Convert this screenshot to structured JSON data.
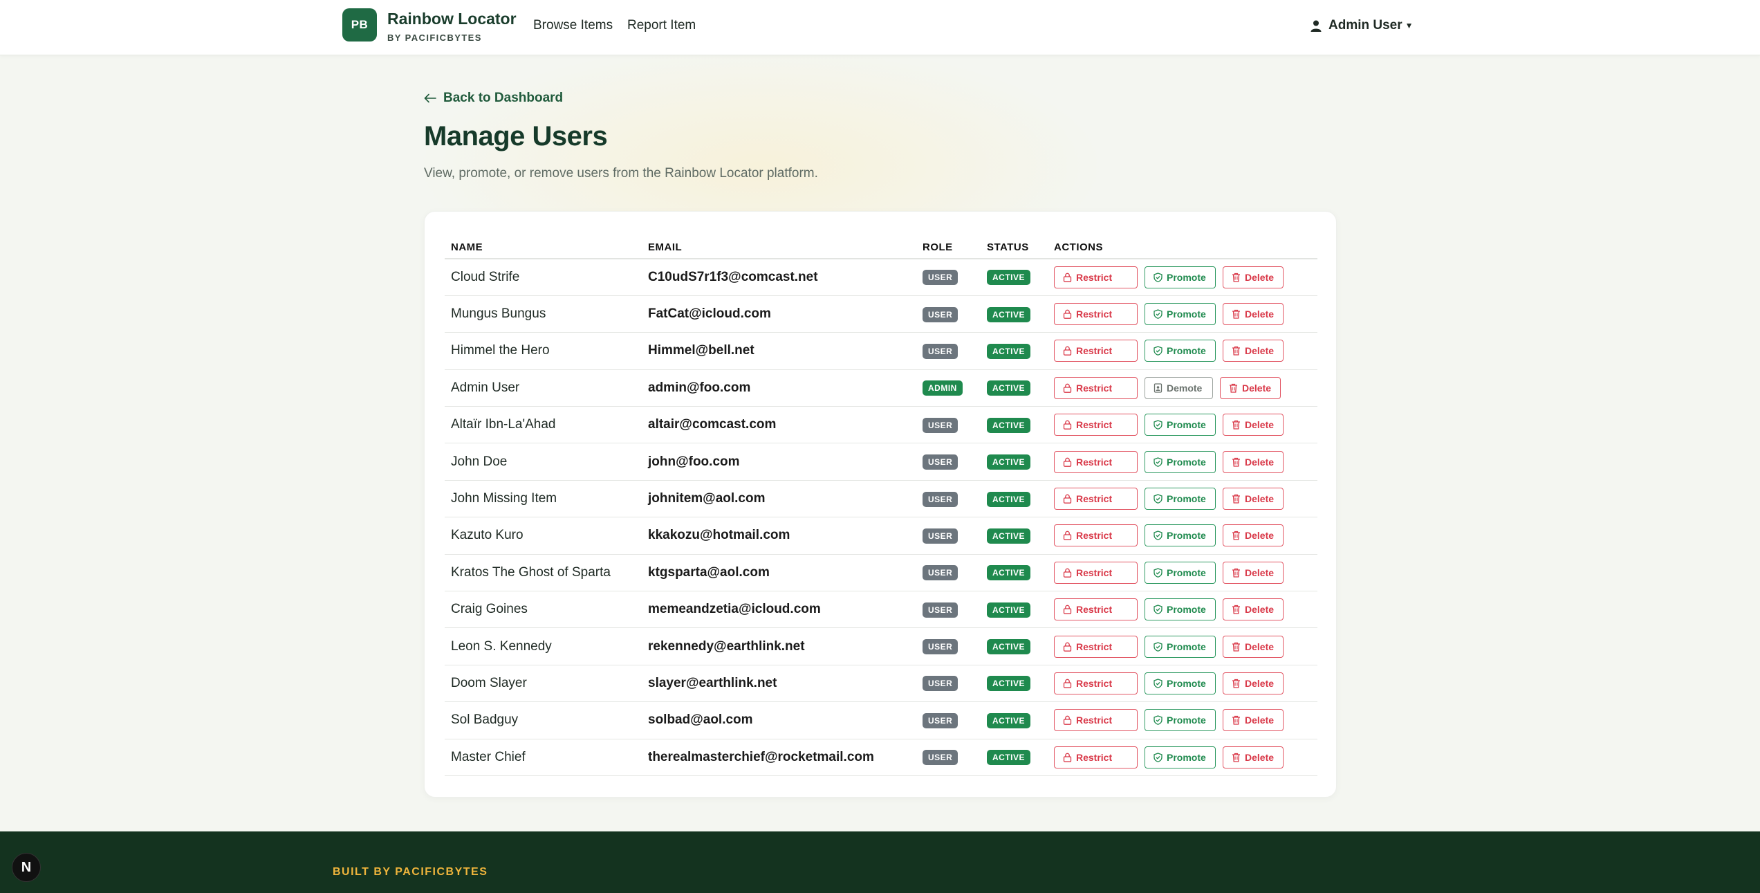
{
  "header": {
    "logo_text": "PB",
    "brand_title": "Rainbow Locator",
    "brand_subtitle": "BY PACIFICBYTES",
    "nav": [
      {
        "label": "Browse Items"
      },
      {
        "label": "Report Item"
      }
    ],
    "user_label": "Admin User",
    "user_icon": "person-icon"
  },
  "main": {
    "back_label": "Back to Dashboard",
    "title": "Manage Users",
    "description": "View, promote, or remove users from the Rainbow Locator platform."
  },
  "table": {
    "headers": [
      "NAME",
      "EMAIL",
      "ROLE",
      "STATUS",
      "ACTIONS"
    ],
    "rows": [
      {
        "name": "Cloud Strife",
        "email": "C10udS7r1f3@comcast.net",
        "role": "USER",
        "status": "ACTIVE",
        "role_action": "Promote"
      },
      {
        "name": "Mungus Bungus",
        "email": "FatCat@icloud.com",
        "role": "USER",
        "status": "ACTIVE",
        "role_action": "Promote"
      },
      {
        "name": "Himmel the Hero",
        "email": "Himmel@bell.net",
        "role": "USER",
        "status": "ACTIVE",
        "role_action": "Promote"
      },
      {
        "name": "Admin User",
        "email": "admin@foo.com",
        "role": "ADMIN",
        "status": "ACTIVE",
        "role_action": "Demote"
      },
      {
        "name": "Altaïr Ibn-La'Ahad",
        "email": "altair@comcast.com",
        "role": "USER",
        "status": "ACTIVE",
        "role_action": "Promote"
      },
      {
        "name": "John Doe",
        "email": "john@foo.com",
        "role": "USER",
        "status": "ACTIVE",
        "role_action": "Promote"
      },
      {
        "name": "John Missing Item",
        "email": "johnitem@aol.com",
        "role": "USER",
        "status": "ACTIVE",
        "role_action": "Promote"
      },
      {
        "name": "Kazuto Kuro",
        "email": "kkakozu@hotmail.com",
        "role": "USER",
        "status": "ACTIVE",
        "role_action": "Promote"
      },
      {
        "name": "Kratos The Ghost of Sparta",
        "email": "ktgsparta@aol.com",
        "role": "USER",
        "status": "ACTIVE",
        "role_action": "Promote"
      },
      {
        "name": "Craig Goines",
        "email": "memeandzetia@icloud.com",
        "role": "USER",
        "status": "ACTIVE",
        "role_action": "Promote"
      },
      {
        "name": "Leon S. Kennedy",
        "email": "rekennedy@earthlink.net",
        "role": "USER",
        "status": "ACTIVE",
        "role_action": "Promote"
      },
      {
        "name": "Doom Slayer",
        "email": "slayer@earthlink.net",
        "role": "USER",
        "status": "ACTIVE",
        "role_action": "Promote"
      },
      {
        "name": "Sol Badguy",
        "email": "solbad@aol.com",
        "role": "USER",
        "status": "ACTIVE",
        "role_action": "Promote"
      },
      {
        "name": "Master Chief",
        "email": "therealmasterchief@rocketmail.com",
        "role": "USER",
        "status": "ACTIVE",
        "role_action": "Promote"
      }
    ],
    "restrict_label": "Restrict",
    "delete_label": "Delete"
  },
  "footer": {
    "text": "BUILT BY PACIFICBYTES",
    "next_badge": "N"
  },
  "colors": {
    "brand_green": "#1f6a44",
    "footer_bg": "#14331f",
    "footer_accent": "#f0b53c",
    "danger": "#d93848",
    "success": "#1f8a4e",
    "muted_badge": "#6c757d"
  }
}
